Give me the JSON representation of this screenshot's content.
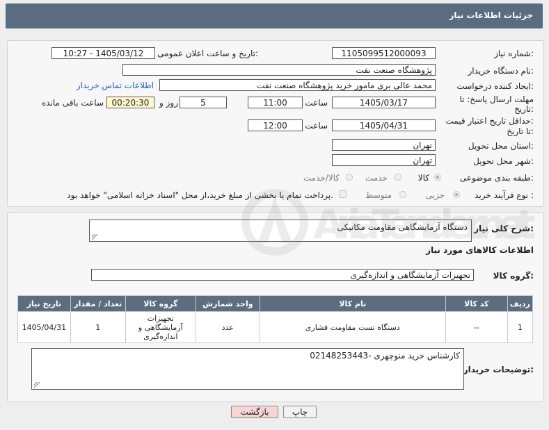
{
  "header": {
    "title": "جزئیات اطلاعات نیاز"
  },
  "form": {
    "need_number_label": "شماره نیاز:",
    "need_number": "1105099512000093",
    "announce_label": "تاریخ و ساعت اعلان عمومی:",
    "announce_value": "1405/03/12 - 10:27",
    "buyer_org_label": "نام دستگاه خریدار:",
    "buyer_org": "پژوهشگاه صنعت نفت",
    "creator_label": "ایجاد کننده درخواست:",
    "creator": "محمد عالی بری مامور خرید پژوهشگاه صنعت نفت",
    "contact_link": "اطلاعات تماس خریدار",
    "deadline_label_1": "مهلت ارسال پاسخ: تا",
    "deadline_label_2": "تاریخ:",
    "deadline_date": "1405/03/17",
    "time_label": "ساعت",
    "deadline_time": "11:00",
    "days_value": "5",
    "days_label": "روز و",
    "remaining_value": "00:20:30",
    "remaining_label": "ساعت باقی مانده",
    "validity_label_1": "حداقل تاریخ اعتبار قیمت:",
    "validity_label_2": "تا تاریخ:",
    "validity_date": "1405/04/31",
    "validity_time": "12:00",
    "province_label": "استان محل تحویل:",
    "province": "تهران",
    "city_label": "شهر محل تحویل:",
    "city": "تهران",
    "category_label": "طبقه بندی موضوعی:",
    "category_options": [
      "کالا",
      "خدمت",
      "کالا/خدمت"
    ],
    "purchase_type_label": "نوع فرآیند خرید :",
    "purchase_options": [
      "جزیی",
      "متوسط"
    ],
    "treasury_note": "پرداخت تمام یا بخشی از مبلغ خرید،از محل \"اسناد خزانه اسلامی\" خواهد بود."
  },
  "details": {
    "summary_label": "شرح کلی نیاز:",
    "summary": "دستگاه آزمایشگاهی مقاومت مکانیکی",
    "goods_info_title": "اطلاعات کالاهای مورد نیاز",
    "goods_group_label": "گروه کالا:",
    "goods_group": "تجهیزات آزمایشگاهی و اندازه‌گیری"
  },
  "table": {
    "headers": [
      "ردیف",
      "کد کالا",
      "نام کالا",
      "واحد شمارش",
      "گروه کالا",
      "تعداد / مقدار",
      "تاریخ نیاز"
    ],
    "rows": [
      {
        "row": "1",
        "code": "--",
        "name": "دستگاه تست مقاومت فشاری",
        "unit": "عدد",
        "group": "تجهیزات آزمایشگاهی و اندازه‌گیری",
        "qty": "1",
        "date": "1405/04/31"
      }
    ]
  },
  "buyer_notes": {
    "label": "توضیحات خریدار:",
    "text": "کارشناس خرید منوچهری -02148253443"
  },
  "buttons": {
    "print": "چاپ",
    "back": "بازگشت"
  },
  "watermark": {
    "text": "AriaTender.net"
  },
  "colors": {
    "header_bg": "#5a6c80",
    "link": "#1a5fc4",
    "back_button": "#f7d5d5"
  }
}
